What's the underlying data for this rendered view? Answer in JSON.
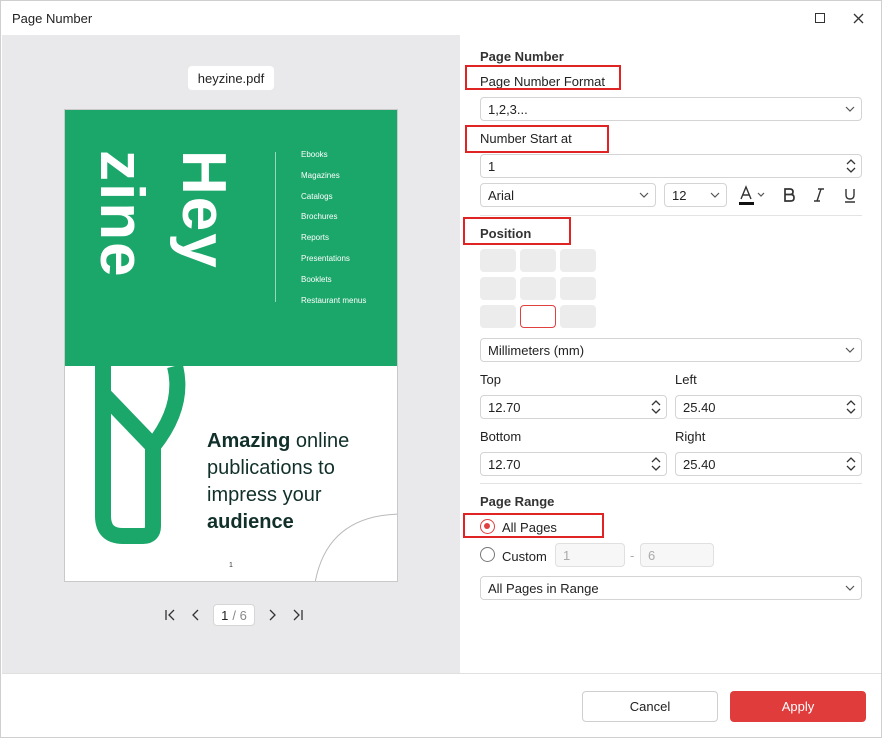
{
  "window": {
    "title": "Page Number"
  },
  "preview": {
    "file_name": "heyzine.pdf",
    "document": {
      "logo_top": "Hey",
      "logo_bottom": "zine",
      "nav": [
        "Ebooks",
        "Magazines",
        "Catalogs",
        "Brochures",
        "Reports",
        "Presentations",
        "Booklets",
        "Restaurant menus"
      ],
      "tagline_bold_1": "Amazing",
      "tagline_rest_1": " online",
      "tagline_2": "publications to",
      "tagline_3": "impress your",
      "tagline_bold_4": "audience",
      "page_number": "1"
    },
    "pager": {
      "current": "1",
      "total": "/ 6"
    }
  },
  "settings": {
    "section_title": "Page Number",
    "format_label": "Page Number Format",
    "format_value": "1,2,3...",
    "start_label": "Number Start at",
    "start_value": "1",
    "font": "Arial",
    "font_size": "12",
    "position_label": "Position",
    "unit_value": "Millimeters (mm)",
    "top_label": "Top",
    "top_value": "12.70",
    "left_label": "Left",
    "left_value": "25.40",
    "bottom_label": "Bottom",
    "bottom_value": "12.70",
    "right_label": "Right",
    "right_value": "25.40",
    "range_label": "Page Range",
    "all_pages_label": "All Pages",
    "custom_label": "Custom",
    "custom_from": "1",
    "custom_dash": "-",
    "custom_to": "6",
    "range_subset": "All Pages in Range"
  },
  "footer": {
    "cancel_label": "Cancel",
    "apply_label": "Apply"
  },
  "colors": {
    "accent": "#e03c3c",
    "brand_green": "#1ba66a"
  }
}
